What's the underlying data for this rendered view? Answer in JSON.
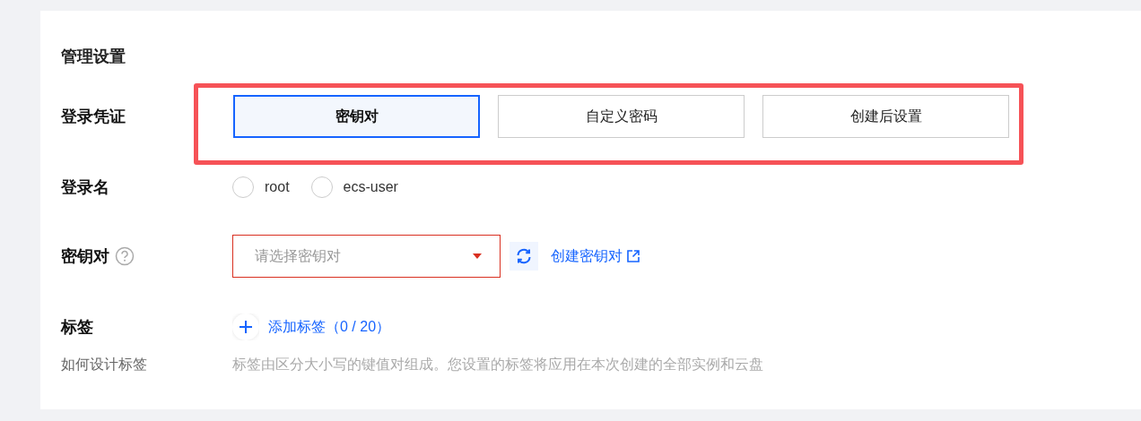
{
  "section_title": "管理设置",
  "login_credential": {
    "label": "登录凭证",
    "options": [
      {
        "label": "密钥对",
        "selected": true
      },
      {
        "label": "自定义密码",
        "selected": false
      },
      {
        "label": "创建后设置",
        "selected": false
      }
    ]
  },
  "login_name": {
    "label": "登录名",
    "options": [
      {
        "label": "root",
        "selected": false
      },
      {
        "label": "ecs-user",
        "selected": false
      }
    ]
  },
  "key_pair": {
    "label": "密钥对",
    "select": {
      "placeholder": "请选择密钥对",
      "error": true
    },
    "create_link": "创建密钥对"
  },
  "tags": {
    "label": "标签",
    "add_link": "添加标签（0 / 20）",
    "help_link": "如何设计标签",
    "hint": "标签由区分大小写的键值对组成。您设置的标签将应用在本次创建的全部实例和云盘"
  }
}
